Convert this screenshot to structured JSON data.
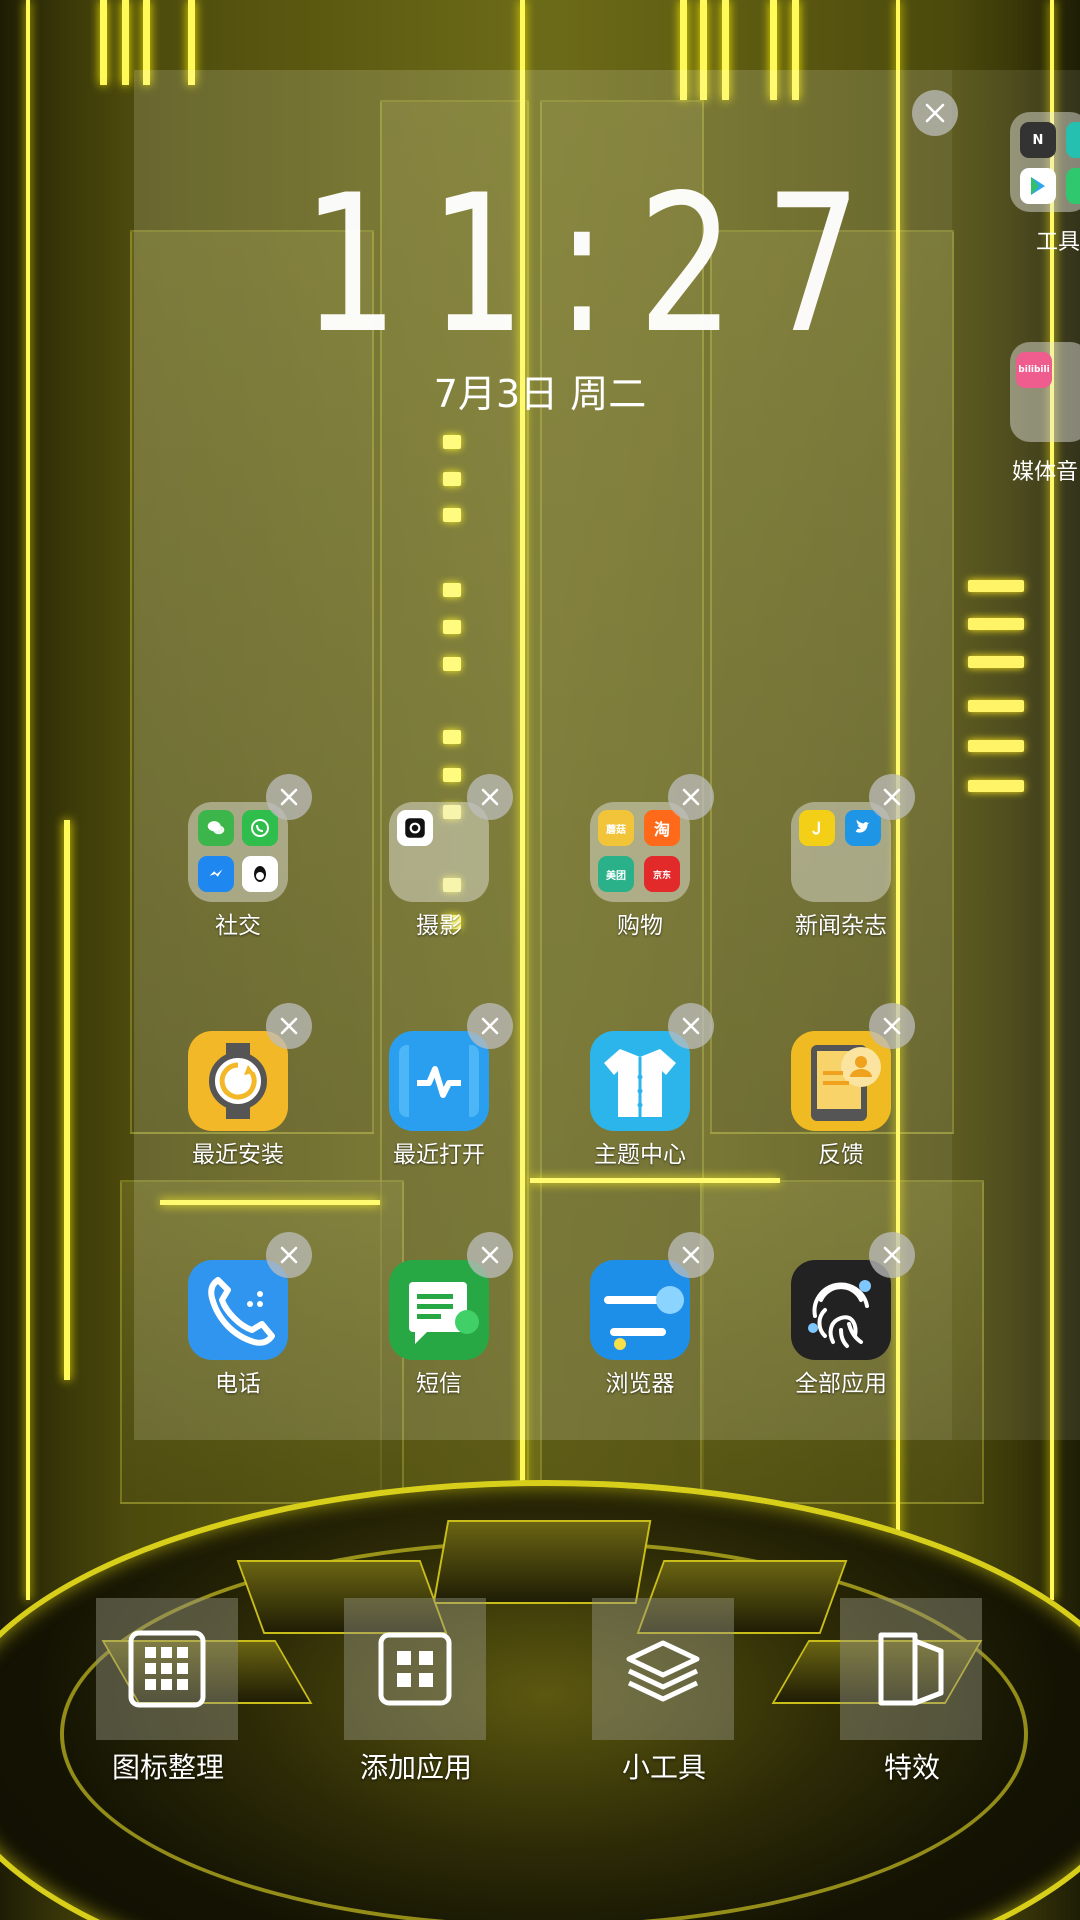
{
  "clock": {
    "time": "11:27",
    "date": "7月3日 周二"
  },
  "side_folders": [
    {
      "label": "工具"
    },
    {
      "label": "媒体音"
    }
  ],
  "apps": [
    {
      "label": "社交"
    },
    {
      "label": "摄影"
    },
    {
      "label": "购物"
    },
    {
      "label": "新闻杂志"
    },
    {
      "label": "最近安装"
    },
    {
      "label": "最近打开"
    },
    {
      "label": "主题中心"
    },
    {
      "label": "反馈"
    },
    {
      "label": "电话"
    },
    {
      "label": "短信"
    },
    {
      "label": "浏览器"
    },
    {
      "label": "全部应用"
    }
  ],
  "folder_minis": {
    "shopping": [
      "蘑菇",
      "淘",
      "美团",
      "京东"
    ],
    "tools": [
      "N"
    ],
    "media": [
      "bilibili"
    ]
  },
  "dock": [
    {
      "label": "图标整理"
    },
    {
      "label": "添加应用"
    },
    {
      "label": "小工具"
    },
    {
      "label": "特效"
    }
  ],
  "colors": {
    "accent_yellow": "#fff95a",
    "phone": "#2f95ee",
    "sms": "#27a845",
    "browser": "#1e8fe8",
    "theme": "#2cb5ea",
    "recent_open": "#2a9ff0",
    "recent_install": "#f2b828",
    "feedback": "#f0bb22",
    "all_apps": "#222222"
  }
}
